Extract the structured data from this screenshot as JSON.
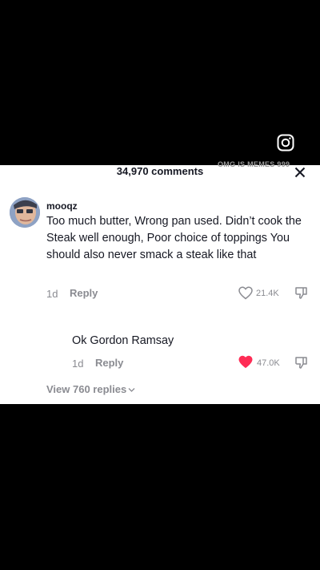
{
  "header": {
    "title": "34,970 comments",
    "watermark": "OMG IS MEMES 999"
  },
  "comment": {
    "username": "mooqz",
    "text": "Too much butter, Wrong pan used. Didn’t cook the Steak well enough, Poor choice of toppings You should also never smack a steak like that",
    "age": "1d",
    "reply_label": "Reply",
    "likes": "21.4K"
  },
  "reply": {
    "text": "Ok Gordon Ramsay",
    "age": "1d",
    "reply_label": "Reply",
    "likes": "47.0K",
    "heart_color": "#fe2c55"
  },
  "view_replies": "View 760 replies",
  "icons": {
    "app": "instagram-icon",
    "close": "close-icon",
    "like": "heart-icon",
    "dislike": "dislike-icon",
    "expand": "chevron-down-icon"
  }
}
